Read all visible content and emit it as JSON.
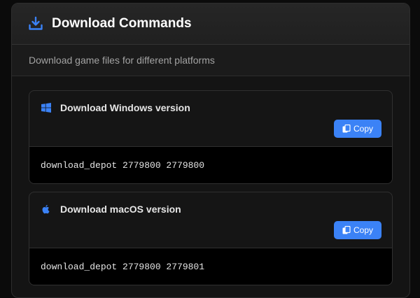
{
  "header": {
    "icon": "download-icon",
    "title": "Download Commands"
  },
  "subtitle": "Download game files for different platforms",
  "accent_color": "#3b82f6",
  "commands": [
    {
      "platform_icon": "windows-icon",
      "title": "Download Windows version",
      "copy_label": "Copy",
      "command": "download_depot 2779800 2779800"
    },
    {
      "platform_icon": "apple-icon",
      "title": "Download macOS version",
      "copy_label": "Copy",
      "command": "download_depot 2779800 2779801"
    }
  ]
}
